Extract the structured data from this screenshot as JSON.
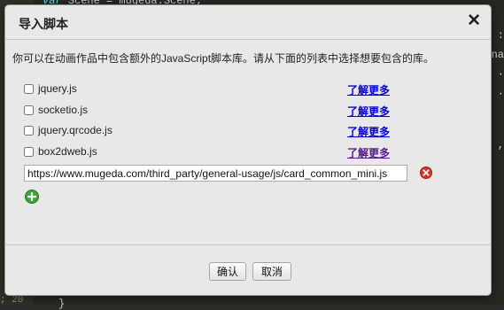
{
  "background": {
    "code_top_keyword": "var",
    "code_top_rest": " Scene = mugeda.Scene;",
    "right_fragments": [
      ":",
      "na",
      ", ·",
      "·",
      ","
    ],
    "code_bottom": "}",
    "line_number": "; 20"
  },
  "dialog": {
    "title": "导入脚本",
    "close_symbol": "✕",
    "description": "你可以在动画作品中包含额外的JavaScript脚本库。请从下面的列表中选择想要包含的库。",
    "libraries": [
      {
        "name": "jquery.js",
        "checked": false,
        "link": "了解更多"
      },
      {
        "name": "socketio.js",
        "checked": false,
        "link": "了解更多"
      },
      {
        "name": "jquery.qrcode.js",
        "checked": false,
        "link": "了解更多"
      },
      {
        "name": "box2dweb.js",
        "checked": false,
        "link": "了解更多"
      }
    ],
    "custom_url": "https://www.mugeda.com/third_party/general-usage/js/card_common_mini.js",
    "buttons": {
      "ok": "确认",
      "cancel": "取消"
    }
  },
  "colors": {
    "link": "#0000ee",
    "link_visited": "#551a8b",
    "remove_icon": "#d9342b",
    "add_icon": "#3aa63a"
  }
}
